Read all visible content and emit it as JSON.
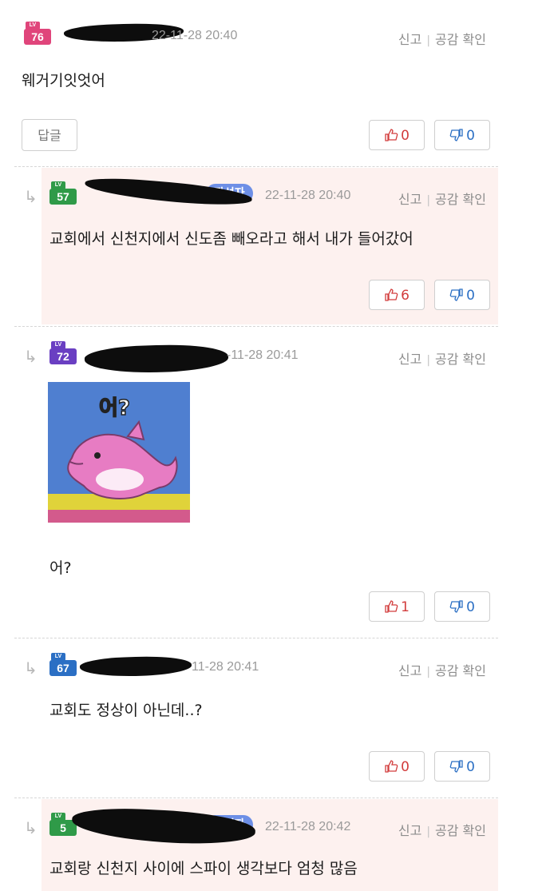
{
  "comments": [
    {
      "level": "76",
      "timestamp": "22-11-28 20:40",
      "report": "신고",
      "empathy": "공감 확인",
      "text": "웨거기잇엇어",
      "reply": "답글",
      "likes": "0",
      "dislikes": "0"
    },
    {
      "level": "57",
      "author_badge": "작성자",
      "timestamp": "22-11-28 20:40",
      "report": "신고",
      "empathy": "공감 확인",
      "text": "교회에서 신천지에서 신도좀 빼오라고 해서 내가 들어갔어",
      "likes": "6",
      "dislikes": "0"
    },
    {
      "level": "72",
      "timestamp": "-11-28 20:41",
      "report": "신고",
      "empathy": "공감 확인",
      "sticker_text": "어?",
      "text": "어?",
      "likes": "1",
      "dislikes": "0"
    },
    {
      "level": "67",
      "timestamp": "11-28 20:41",
      "report": "신고",
      "empathy": "공감 확인",
      "text": "교회도 정상이 아닌데..?",
      "likes": "0",
      "dislikes": "0"
    },
    {
      "level": "5",
      "author_badge": "작성자",
      "timestamp": "22-11-28 20:42",
      "report": "신고",
      "empathy": "공감 확인",
      "text": "교회랑 신천지 사이에 스파이 생각보다 엄청 많음"
    }
  ],
  "level_tag": "LV",
  "colors": {
    "lv76": "#e0457b",
    "lv57": "#2f9a48",
    "lv72": "#6a3fc2",
    "lv67": "#2b6fc4",
    "author_row_bg": "#fdf1ef",
    "author_badge": "#6d8fe6"
  }
}
